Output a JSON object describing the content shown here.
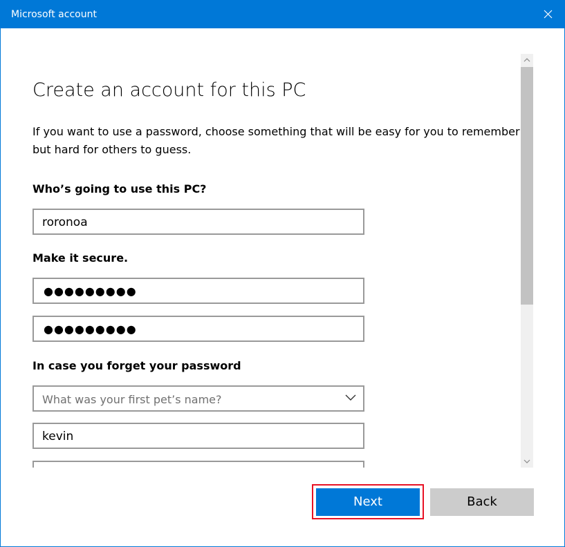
{
  "window": {
    "title": "Microsoft account",
    "accent_color": "#0078d7",
    "close_icon": "close-icon"
  },
  "page": {
    "heading": "Create an account for this PC",
    "intro": "If you want to use a password, choose something that will be easy for you to remember but hard for others to guess."
  },
  "user": {
    "label": "Who’s going to use this PC?",
    "username_value": "roronoa"
  },
  "security": {
    "label": "Make it secure.",
    "password_mask": "●●●●●●●●●",
    "confirm_mask": "●●●●●●●●●"
  },
  "recovery": {
    "label": "In case you forget your password",
    "question_placeholder": "What was your first pet’s name?",
    "answer_value": "kevin"
  },
  "buttons": {
    "next": "Next",
    "back": "Back"
  }
}
